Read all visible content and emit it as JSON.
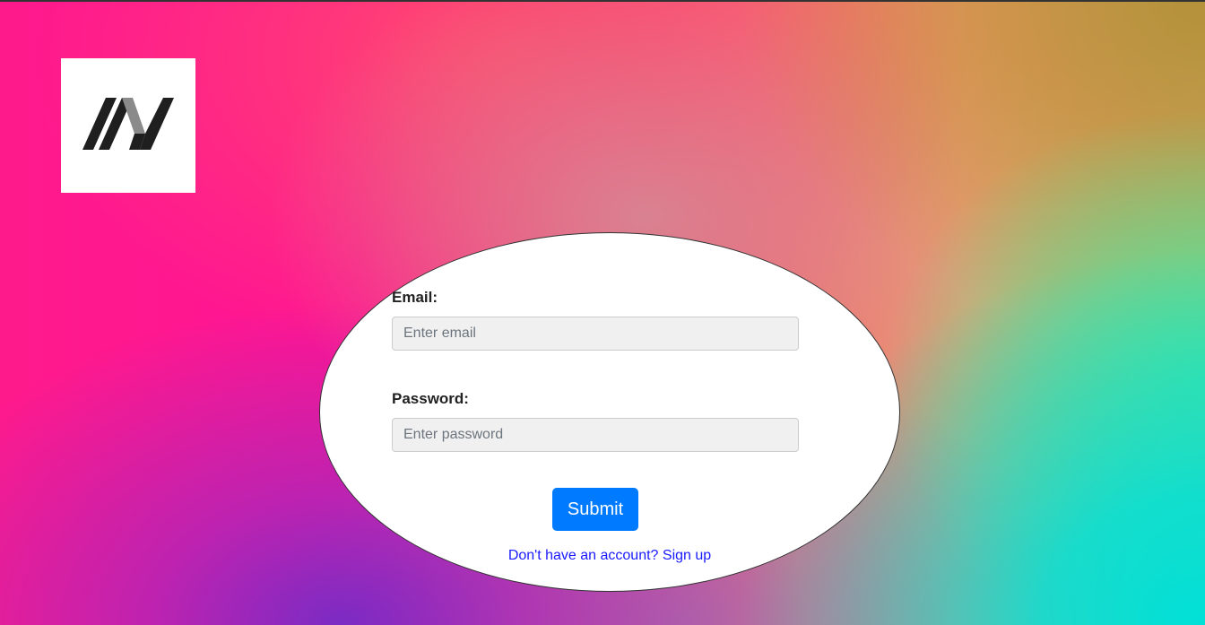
{
  "logo": {
    "icon": "brand-logo-icon",
    "colors": [
      "#1f1f1f",
      "#8a8a8a"
    ]
  },
  "form": {
    "email_label": "Email:",
    "email_placeholder": "Enter email",
    "email_value": "",
    "password_label": "Password:",
    "password_placeholder": "Enter password",
    "password_value": "",
    "submit_label": "Submit",
    "signup_text": "Don't have an account? Sign up"
  },
  "colors": {
    "button": "#007bff",
    "link": "#1a1aff",
    "input_bg": "#f0f0f0"
  }
}
